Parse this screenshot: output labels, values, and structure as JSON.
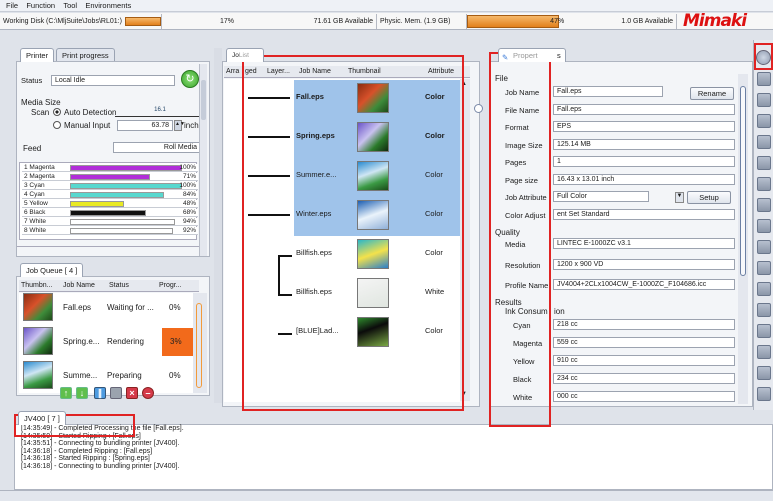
{
  "menu": [
    "File",
    "Function",
    "Tool",
    "Environments"
  ],
  "status": {
    "disk_label": "Working Disk (C:\\MljSuite\\Jobs\\RL01:)",
    "disk_pct": "17%",
    "disk_avail": "71.61 GB Available",
    "mem_label": "Physic. Mem. (1.9 GB)",
    "mem_pct": "47%",
    "mem_avail": "1.0 GB Available",
    "logo": "Mimaki"
  },
  "left": {
    "tabs": [
      "Printer",
      "Print progress"
    ],
    "status_label": "Status",
    "status_value": "Local Idle",
    "media_size": "Media Size",
    "scan": "Scan",
    "auto": "Auto Detection",
    "auto_value": "16.1",
    "manual": "Manual Input",
    "manual_value": "63.78",
    "unit": "inch",
    "feed": "Feed",
    "feed_value": "Roll Media",
    "inks": [
      {
        "name": "1 Magenta",
        "pct": "100%",
        "level": 1.0,
        "color": "#b12fd8"
      },
      {
        "name": "2 Magenta",
        "pct": "71%",
        "level": 0.71,
        "color": "#b12fd8"
      },
      {
        "name": "3 Cyan",
        "pct": "100%",
        "level": 1.0,
        "color": "#57d8cf"
      },
      {
        "name": "4 Cyan",
        "pct": "84%",
        "level": 0.84,
        "color": "#57d8cf"
      },
      {
        "name": "5 Yellow",
        "pct": "48%",
        "level": 0.48,
        "color": "#e9ea24"
      },
      {
        "name": "6 Black",
        "pct": "68%",
        "level": 0.68,
        "color": "#111"
      },
      {
        "name": "7 White",
        "pct": "94%",
        "level": 0.94,
        "color": "#ffffff"
      },
      {
        "name": "8 White",
        "pct": "92%",
        "level": 0.92,
        "color": "#ffffff"
      }
    ]
  },
  "queue": {
    "tab": "Job Queue [ 4 ]",
    "cols": [
      "Thumbn...",
      "Job Name",
      "Status",
      "Progr..."
    ],
    "rows": [
      {
        "name": "Fall.eps",
        "status": "Waiting for ...",
        "prog": "0%"
      },
      {
        "name": "Spring.e...",
        "status": "Rendering",
        "prog": "3%"
      },
      {
        "name": "Summe...",
        "status": "Preparing",
        "prog": "0%"
      }
    ]
  },
  "center": {
    "tab": "Jo",
    "tab2": "List",
    "cols": [
      "Arra",
      "ged",
      "Layer...",
      "Job Name",
      "Thumbnail",
      "Attribute"
    ],
    "rows": [
      {
        "name": "Fall.eps",
        "attr": "Color"
      },
      {
        "name": "Spring.eps",
        "attr": "Color"
      },
      {
        "name": "Summer.e...",
        "attr": "Color"
      },
      {
        "name": "Winter.eps",
        "attr": "Color"
      },
      {
        "name": "Billfish.eps",
        "attr": "Color"
      },
      {
        "name": "Billfish.eps",
        "attr": "White"
      },
      {
        "name": "[BLUE]Lad...",
        "attr": "Color"
      }
    ]
  },
  "props": {
    "tab": "Propert",
    "tab_tail": "s",
    "file": "File",
    "rows": [
      {
        "label": "Job Name",
        "value": "Fall.eps"
      },
      {
        "label": "File Name",
        "value": "Fall.eps"
      },
      {
        "label": "Format",
        "value": "EPS"
      },
      {
        "label": "Image Size",
        "value": "125.14 MB"
      },
      {
        "label": "Pages",
        "value": "1"
      },
      {
        "label": "Page size",
        "value": "16.43 x 13.01 inch"
      },
      {
        "label": "Job Attribute",
        "value": "Full Color"
      },
      {
        "label": "Color Adjust",
        "value": "ent Set Standard"
      }
    ],
    "rename": "Rename",
    "setup": "Setup",
    "quality": "Quality",
    "media_label": "Media",
    "media": "LINTEC E-1000ZC v3.1",
    "res_label": "Resolution",
    "res": "1200 x 900 VD",
    "profile_label": "Profile Name",
    "profile": "JV4004+2CLx1004CW_E-1000ZC_F104686.icc",
    "results": "Results",
    "ink_consum": "Ink Consum",
    "ink_consum_tail": "ion",
    "inks": [
      {
        "label": "Cyan",
        "value": "218 cc"
      },
      {
        "label": "Magenta",
        "value": "559 cc"
      },
      {
        "label": "Yellow",
        "value": "910 cc"
      },
      {
        "label": "Black",
        "value": "234 cc"
      },
      {
        "label": "White",
        "value": "000 cc"
      }
    ]
  },
  "log": {
    "tab": "JV400 [ 7 ]",
    "lines": [
      "[14:35:49] - Completed Processing the file [Fall.eps].",
      "[14:35:50] - Started Ripping : [Fall.eps]",
      "[14:35:51] - Connecting to bundling printer [JV400].",
      "[14:36:18] - Completed Ripping : [Fall.eps]",
      "[14:36:18] - Started Ripping : [Spring.eps]",
      "[14:36:18] - Connecting to bundling printer [JV400]."
    ]
  },
  "colors": {
    "accent": "#e02323",
    "selected": "#9fc3ea",
    "render": "#f26a1b"
  }
}
